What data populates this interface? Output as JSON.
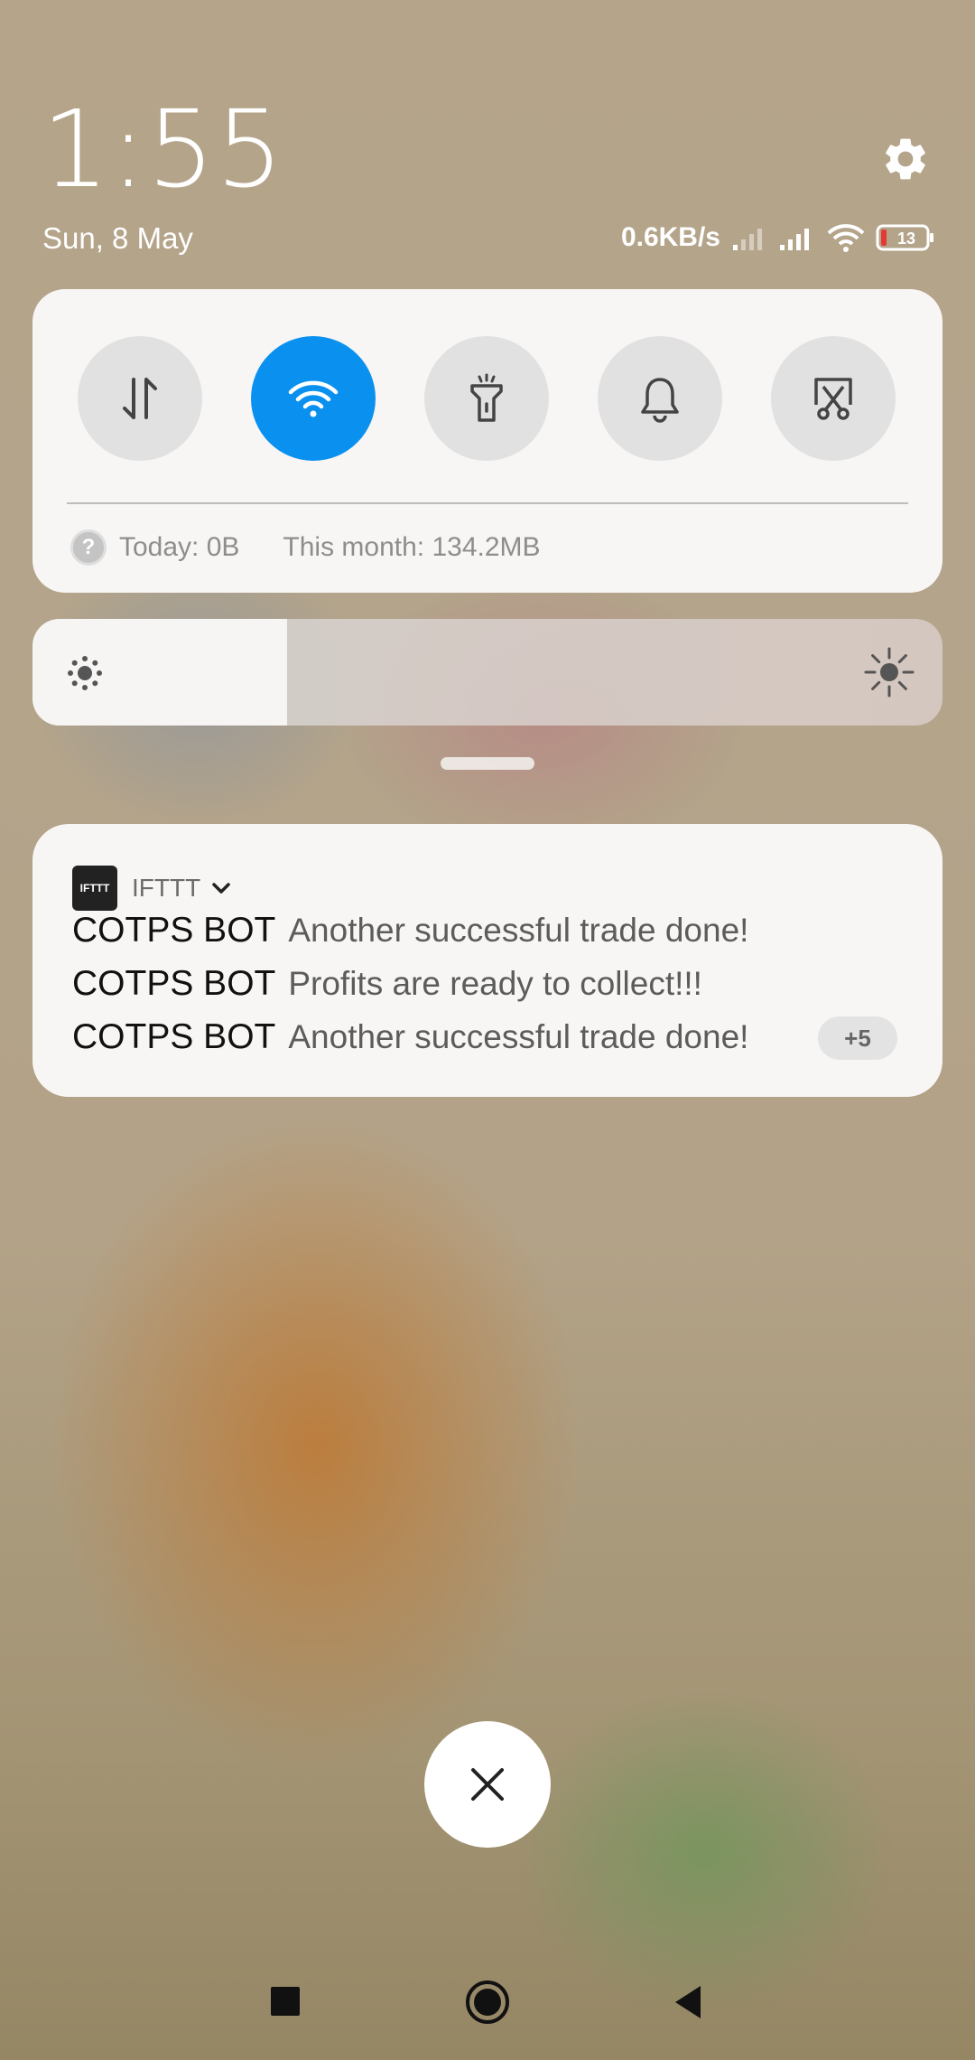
{
  "clock": {
    "time": "1:55",
    "date": "Sun, 8 May"
  },
  "status": {
    "net_speed": "0.6KB/s",
    "battery": "13"
  },
  "quick_settings": {
    "toggles": [
      {
        "name": "mobile-data",
        "active": false
      },
      {
        "name": "wifi",
        "active": true
      },
      {
        "name": "flashlight",
        "active": false
      },
      {
        "name": "notifications-sound",
        "active": false
      },
      {
        "name": "screenshot",
        "active": false
      }
    ],
    "help_glyph": "?",
    "data_today": "Today: 0B",
    "data_month": "This month: 134.2MB"
  },
  "brightness": {
    "level_percent": 28
  },
  "notification": {
    "app_icon_text": "IFTTT",
    "app_name": "IFTTT",
    "lines": [
      {
        "sender": "COTPS BOT",
        "message": "Another successful trade done!"
      },
      {
        "sender": "COTPS BOT",
        "message": "Profits are ready to collect!!!"
      },
      {
        "sender": "COTPS BOT",
        "message": "Another successful trade done!"
      }
    ],
    "more_badge": "+5"
  },
  "colors": {
    "accent": "#0a91f0",
    "panel": "#faf9f8"
  }
}
